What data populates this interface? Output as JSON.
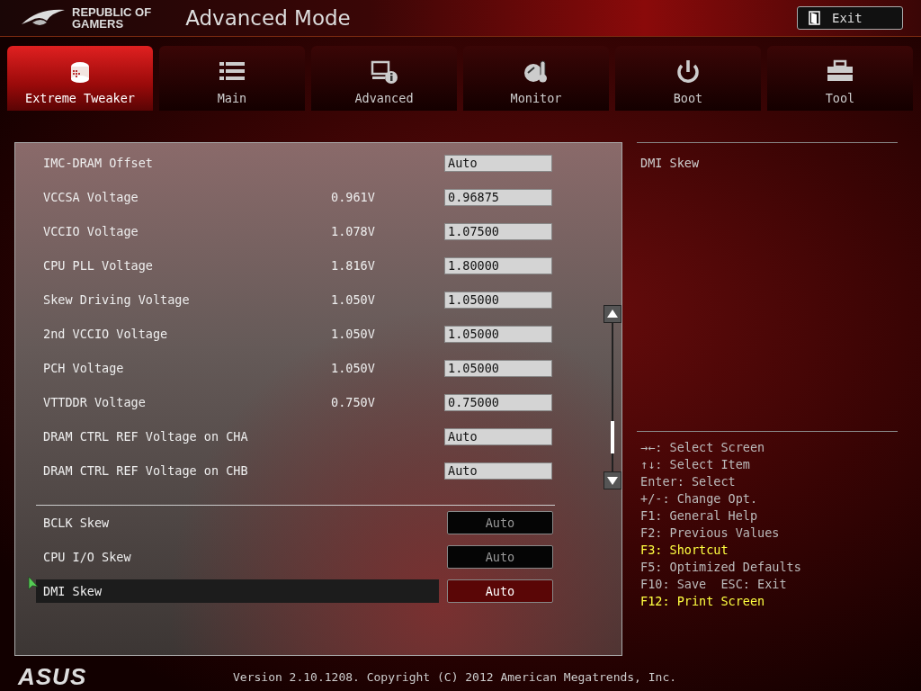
{
  "header": {
    "logo_lines": [
      "REPUBLIC OF",
      "GAMERS"
    ],
    "title": "Advanced Mode",
    "exit_button": "Exit"
  },
  "tabs": [
    {
      "label": "Extreme Tweaker",
      "selected": true
    },
    {
      "label": "Main",
      "selected": false
    },
    {
      "label": "Advanced",
      "selected": false
    },
    {
      "label": "Monitor",
      "selected": false
    },
    {
      "label": "Boot",
      "selected": false
    },
    {
      "label": "Tool",
      "selected": false
    }
  ],
  "settings": [
    {
      "kind": "field",
      "label": "IMC-DRAM Offset",
      "value": "Auto",
      "selected": false
    },
    {
      "kind": "field",
      "label": "VCCSA Voltage",
      "reading": "0.961V",
      "value": "0.96875",
      "selected": false
    },
    {
      "kind": "field",
      "label": "VCCIO Voltage",
      "reading": "1.078V",
      "value": "1.07500",
      "selected": false
    },
    {
      "kind": "field",
      "label": "CPU PLL Voltage",
      "reading": "1.816V",
      "value": "1.80000",
      "selected": false
    },
    {
      "kind": "field",
      "label": "Skew Driving Voltage",
      "reading": "1.050V",
      "value": "1.05000",
      "selected": false
    },
    {
      "kind": "field",
      "label": "2nd VCCIO Voltage",
      "reading": "1.050V",
      "value": "1.05000",
      "selected": false
    },
    {
      "kind": "field",
      "label": "PCH Voltage",
      "reading": "1.050V",
      "value": "1.05000",
      "selected": false
    },
    {
      "kind": "field",
      "label": "VTTDDR Voltage",
      "reading": "0.750V",
      "value": "0.75000",
      "selected": false
    },
    {
      "kind": "field",
      "label": "DRAM CTRL REF Voltage on CHA",
      "value": "Auto",
      "selected": false
    },
    {
      "kind": "field",
      "label": "DRAM CTRL REF Voltage on CHB",
      "value": "Auto",
      "selected": false
    },
    {
      "kind": "button",
      "label": "BCLK Skew",
      "value": "Auto",
      "selected": false
    },
    {
      "kind": "button",
      "label": "CPU I/O Skew",
      "value": "Auto",
      "selected": false
    },
    {
      "kind": "button",
      "label": "DMI Skew",
      "value": "Auto",
      "selected": true
    }
  ],
  "help": {
    "title": "DMI Skew"
  },
  "shortcuts": [
    {
      "text": "→←: Select Screen",
      "highlighted": false
    },
    {
      "text": "↑↓: Select Item",
      "highlighted": false
    },
    {
      "text": "Enter: Select",
      "highlighted": false
    },
    {
      "text": "+/-: Change Opt.",
      "highlighted": false
    },
    {
      "text": "F1: General Help",
      "highlighted": false
    },
    {
      "text": "F2: Previous Values",
      "highlighted": false
    },
    {
      "text": "F3: Shortcut",
      "highlighted": true
    },
    {
      "text": "F5: Optimized Defaults",
      "highlighted": false
    },
    {
      "text": "F10: Save  ESC: Exit",
      "highlighted": false
    },
    {
      "text": "F12: Print Screen",
      "highlighted": true
    }
  ],
  "footer": {
    "logo": "ASUS",
    "version": "Version 2.10.1208. Copyright (C) 2012 American Megatrends, Inc."
  }
}
